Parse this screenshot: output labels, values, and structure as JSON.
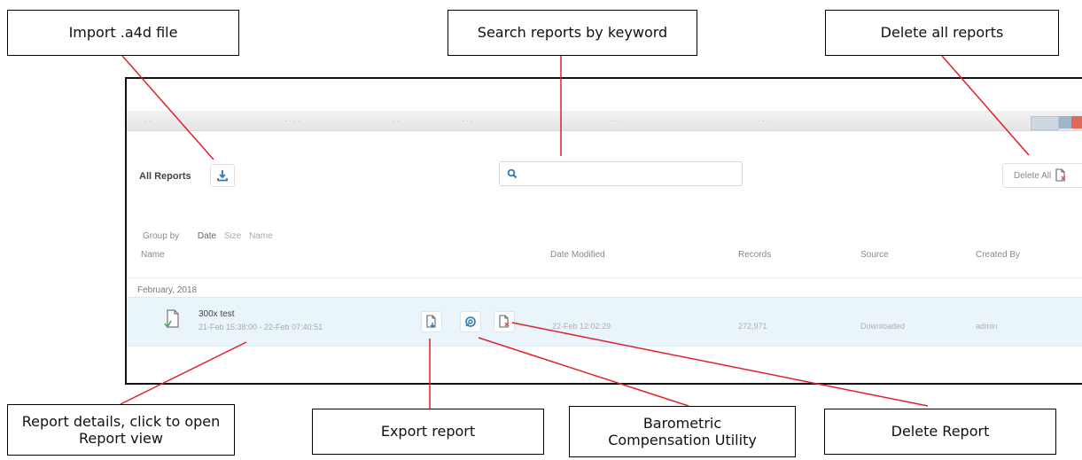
{
  "callouts": {
    "import": "Import .a4d file",
    "search": "Search reports by keyword",
    "delete_all": "Delete all reports",
    "report_details": "Report details, click to open Report view",
    "export": "Export report",
    "barometric": "Barometric Compensation Utility",
    "delete_report": "Delete Report"
  },
  "app": {
    "title": "All Reports",
    "search": {
      "placeholder": "",
      "value": ""
    },
    "delete_all_label": "Delete All",
    "group_by": {
      "label": "Group by",
      "options": [
        "Date",
        "Size",
        "Name"
      ],
      "selected": "Date"
    },
    "columns": [
      "Name",
      "Date Modified",
      "Records",
      "Source",
      "Created By"
    ],
    "month_group": "February, 2018",
    "reports": [
      {
        "name": "300x test",
        "range": "21-Feb 15:38:00 - 22-Feb 07:40:51",
        "date_modified": "22-Feb 12:02:29",
        "records": "272,971",
        "source": "Downloaded",
        "created_by": "admin"
      }
    ]
  },
  "colors": {
    "accent_blue": "#2a7ab8",
    "callout_line": "#e0202a",
    "row_highlight": "#eaf4fb",
    "delete_red": "#d9534f"
  },
  "icons": [
    "download-icon",
    "search-icon",
    "delete-file-icon",
    "report-file-icon",
    "export-file-icon",
    "barometric-link-icon"
  ]
}
